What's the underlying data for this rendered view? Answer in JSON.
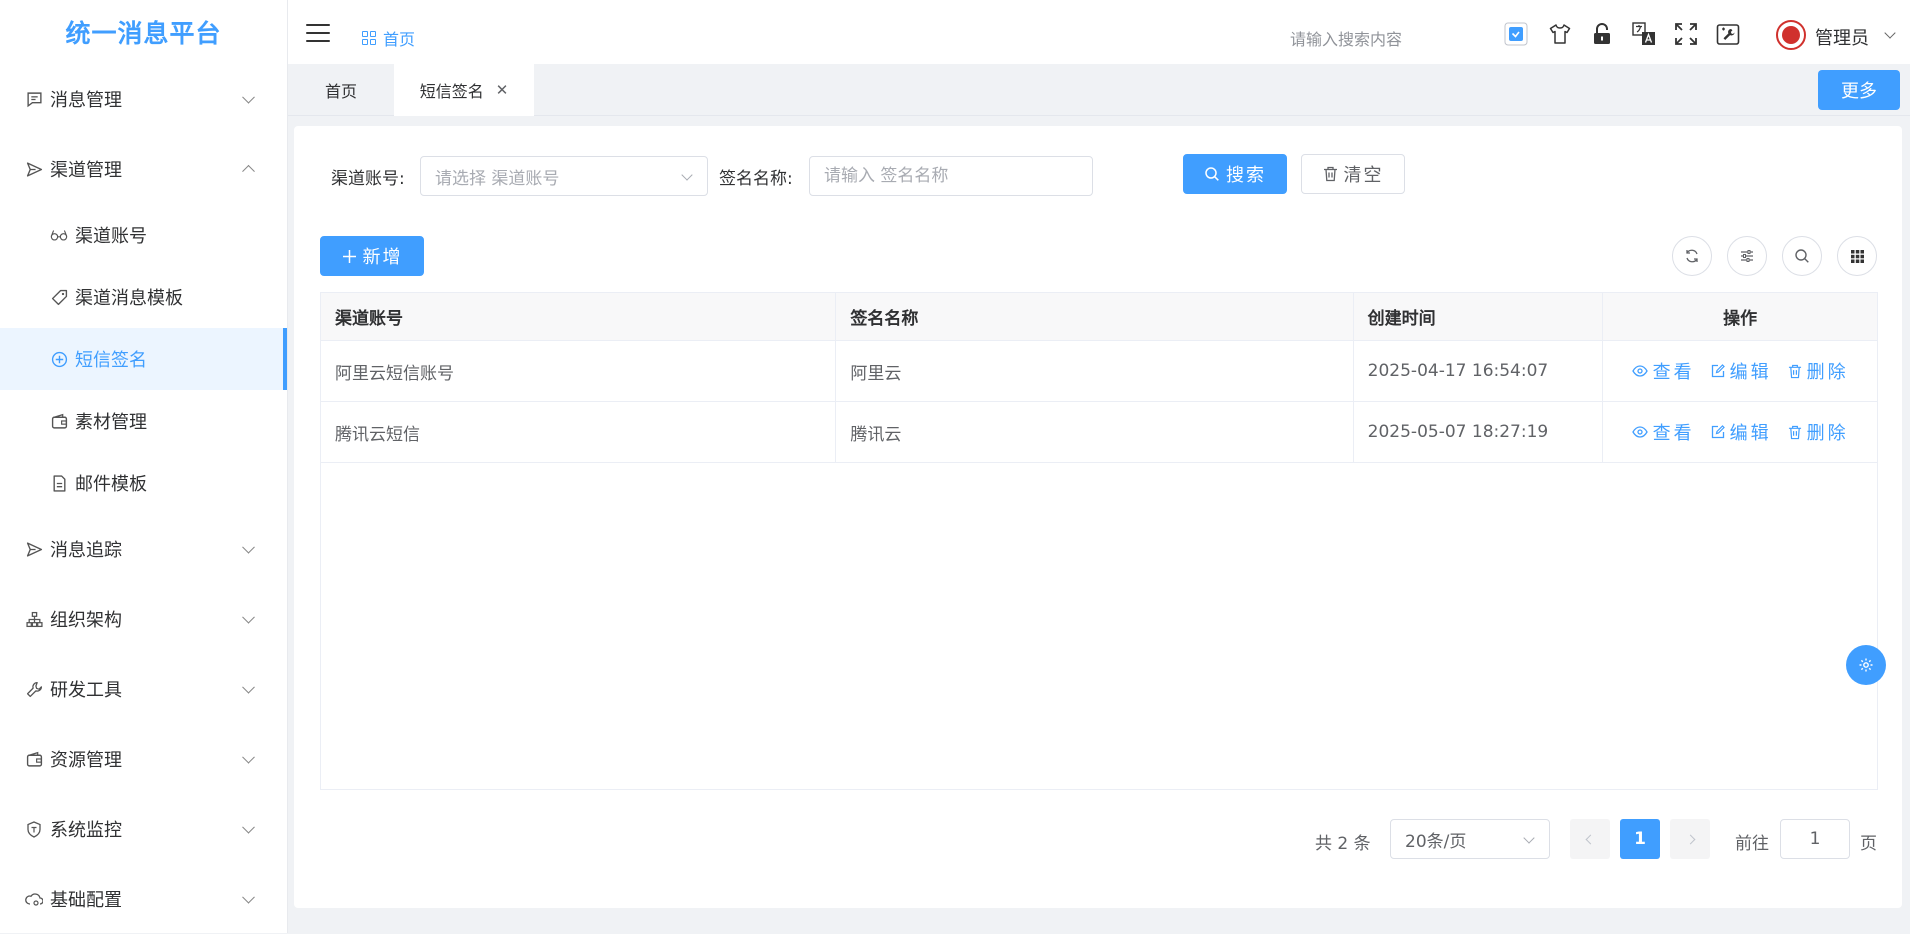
{
  "app": {
    "title": "统一消息平台"
  },
  "sidebar": {
    "items": [
      {
        "label": "消息管理",
        "icon": "message-icon",
        "expanded": false
      },
      {
        "label": "渠道管理",
        "icon": "send-icon",
        "expanded": true,
        "children": [
          {
            "label": "渠道账号",
            "icon": "glasses-icon"
          },
          {
            "label": "渠道消息模板",
            "icon": "tag-icon"
          },
          {
            "label": "短信签名",
            "icon": "circle-plus-icon",
            "active": true
          },
          {
            "label": "素材管理",
            "icon": "wallet-icon"
          },
          {
            "label": "邮件模板",
            "icon": "document-icon"
          }
        ]
      },
      {
        "label": "消息追踪",
        "icon": "send-icon",
        "expanded": false
      },
      {
        "label": "组织架构",
        "icon": "org-chart-icon",
        "expanded": false
      },
      {
        "label": "研发工具",
        "icon": "wrench-icon",
        "expanded": false
      },
      {
        "label": "资源管理",
        "icon": "wallet-icon",
        "expanded": false
      },
      {
        "label": "系统监控",
        "icon": "shield-icon",
        "expanded": false
      },
      {
        "label": "基础配置",
        "icon": "cloud-gear-icon",
        "expanded": false
      }
    ]
  },
  "header": {
    "breadcrumb": "首页",
    "search_placeholder": "请输入搜索内容",
    "username": "管理员"
  },
  "tabs": {
    "items": [
      {
        "label": "首页"
      },
      {
        "label": "短信签名",
        "closable": true
      }
    ],
    "close_glyph": "✕",
    "more_label": "更多"
  },
  "filters": {
    "account_label": "渠道账号:",
    "account_placeholder": "请选择 渠道账号",
    "sign_label": "签名名称:",
    "sign_placeholder": "请输入 签名名称",
    "search_label": "搜索",
    "clear_label": "清空",
    "add_label": "新增"
  },
  "table": {
    "columns": [
      "渠道账号",
      "签名名称",
      "创建时间",
      "操作"
    ],
    "rows": [
      {
        "account": "阿里云短信账号",
        "sign": "阿里云",
        "created": "2025-04-17 16:54:07"
      },
      {
        "account": "腾讯云短信",
        "sign": "腾讯云",
        "created": "2025-05-07 18:27:19"
      }
    ],
    "actions": {
      "view": "查看",
      "edit": "编辑",
      "delete": "删除"
    }
  },
  "pagination": {
    "total_text": "共 2 条",
    "page_size": "20条/页",
    "current_page": "1",
    "goto_label": "前往",
    "goto_value": "1",
    "page_suffix": "页"
  },
  "colors": {
    "primary": "#409eff",
    "active_bg": "#ecf5ff",
    "text": "#303133"
  }
}
